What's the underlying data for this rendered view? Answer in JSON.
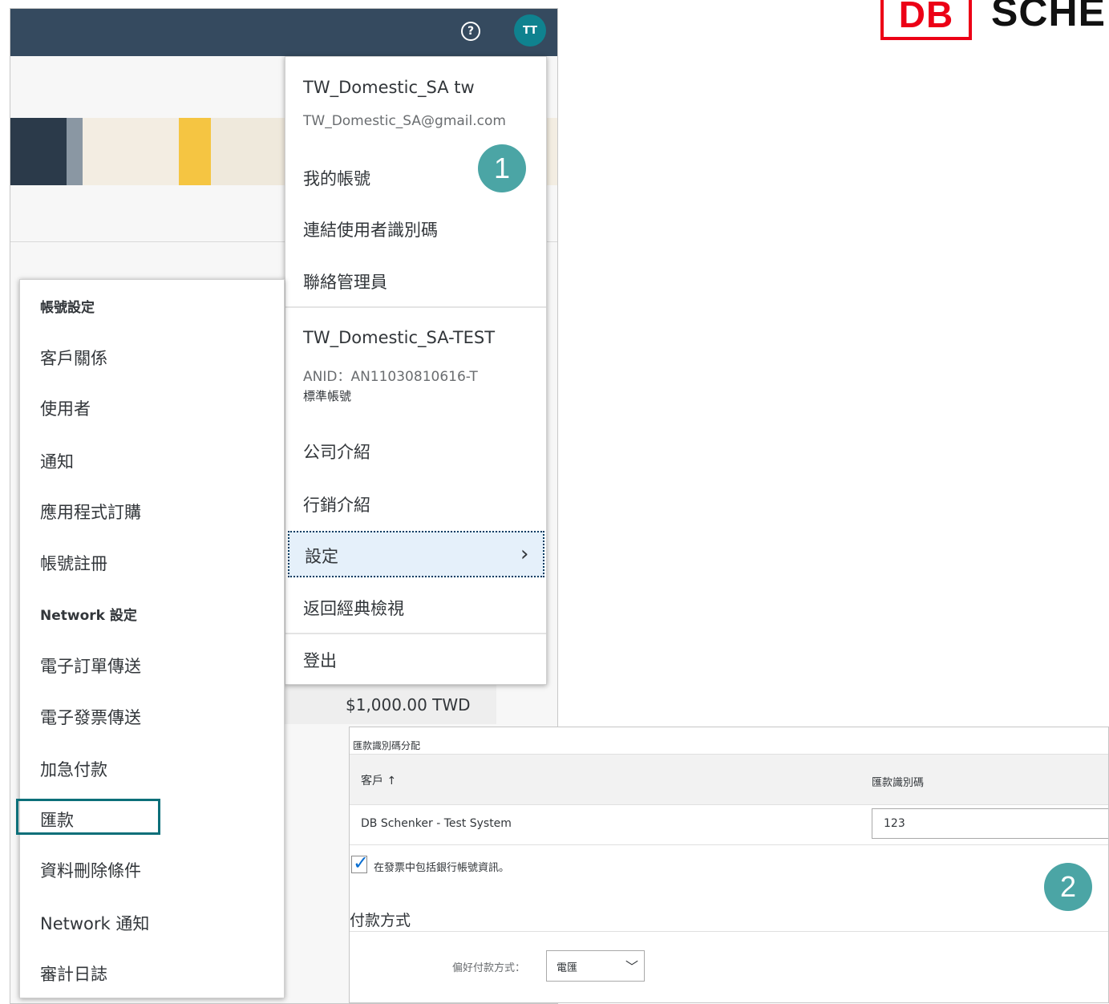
{
  "topbar": {
    "help_icon": "?",
    "avatar_initials": "TT"
  },
  "user_menu": {
    "user_name": "TW_Domestic_SA tw",
    "user_email": "TW_Domestic_SA@gmail.com",
    "my_account": "我的帳號",
    "link_user_ids": "連結使用者識別碼",
    "contact_admin": "聯絡管理員",
    "org_name": "TW_Domestic_SA-TEST",
    "anid": "ANID：AN11030810616-T",
    "account_type": "標準帳號",
    "company_profile": "公司介紹",
    "marketing_profile": "行銷介紹",
    "settings": "設定",
    "classic_view": "返回經典檢視",
    "logout": "登出"
  },
  "settings_menu": {
    "account_settings_header": "帳號設定",
    "customer_relationships": "客戶關係",
    "users": "使用者",
    "notifications": "通知",
    "app_subscriptions": "應用程式訂購",
    "account_registration": "帳號註冊",
    "network_settings_header": "Network 設定",
    "electronic_order_routing": "電子訂單傳送",
    "electronic_invoice_routing": "電子發票傳送",
    "accelerated_payments": "加急付款",
    "remittances": "匯款",
    "data_deletion_criteria": "資料刪除條件",
    "network_notifications": "Network 通知",
    "audit_logs": "審計日誌"
  },
  "background": {
    "amount": "$1,000.00 TWD"
  },
  "badges": {
    "step1": "1",
    "step2": "2"
  },
  "logo": {
    "db": "DB",
    "wordmark": "SCHE"
  },
  "remittance_panel": {
    "title": "匯款識別碼分配",
    "col_customer": "客戶 ↑",
    "col_remit_id": "匯款識別碼",
    "customer_name": "DB Schenker - Test System",
    "remit_id_value": "123",
    "include_bank_info": "在發票中包括銀行帳號資訊。",
    "include_bank_info_checked": true,
    "payment_section": "付款方式",
    "preferred_method_label": "偏好付款方式：",
    "preferred_method_value": "電匯"
  },
  "colors": {
    "topbar": "#354a5f",
    "avatar": "#0f828f",
    "badge": "#4ba5a5",
    "highlight_border": "#0b6f79",
    "db_red": "#ec0016",
    "selected_row": "#e5f0fa"
  }
}
